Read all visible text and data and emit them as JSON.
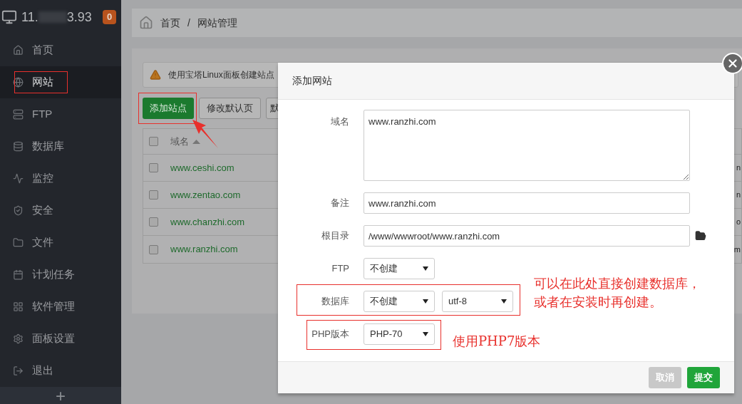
{
  "sidebar": {
    "server": {
      "ip_start": "11.",
      "ip_end": "3.93",
      "badge": "0"
    },
    "items": [
      {
        "label": "首页",
        "selected": false
      },
      {
        "label": "网站",
        "selected": true
      },
      {
        "label": "FTP",
        "selected": false
      },
      {
        "label": "数据库",
        "selected": false
      },
      {
        "label": "监控",
        "selected": false
      },
      {
        "label": "安全",
        "selected": false
      },
      {
        "label": "文件",
        "selected": false
      },
      {
        "label": "计划任务",
        "selected": false
      },
      {
        "label": "软件管理",
        "selected": false
      },
      {
        "label": "面板设置",
        "selected": false
      },
      {
        "label": "退出",
        "selected": false
      }
    ],
    "add": "+"
  },
  "breadcrumb": {
    "items": [
      "首页",
      "网站管理"
    ],
    "separator": "/"
  },
  "alert": "使用宝塔Linux面板创建站点",
  "toolbar": [
    {
      "label": "添加站点",
      "kind": "primary"
    },
    {
      "label": "修改默认页",
      "kind": "default"
    },
    {
      "label": "默",
      "kind": "default"
    }
  ],
  "table": {
    "columns": [
      "域名"
    ],
    "header_checked": false,
    "rows": [
      {
        "checked": false,
        "domain": "www.ceshi.com",
        "column_3": "n"
      },
      {
        "checked": false,
        "domain": "www.zentao.com",
        "column_3": "n"
      },
      {
        "checked": false,
        "domain": "www.chanzhi.com",
        "column_3": "o"
      },
      {
        "checked": false,
        "domain": "www.ranzhi.com",
        "column_3": "m"
      }
    ]
  },
  "dialog": {
    "title": "添加网站",
    "fields": [
      {
        "kind": "textarea",
        "label": "域名",
        "value": "www.ranzhi.com"
      },
      {
        "kind": "input",
        "label": "备注",
        "value": "www.ranzhi.com"
      },
      {
        "kind": "path",
        "label": "根目录",
        "value": "/www/wwwroot/www.ranzhi.com"
      },
      {
        "kind": "select",
        "label": "FTP",
        "values": [
          "不创建"
        ]
      },
      {
        "kind": "select",
        "label": "数据库",
        "values": [
          "不创建",
          "utf-8"
        ]
      },
      {
        "kind": "select",
        "label": "PHP版本",
        "values": [
          "PHP-70"
        ]
      }
    ],
    "buttons": [
      {
        "label": "取消",
        "kind": "cancel"
      },
      {
        "label": "提交",
        "kind": "submit"
      }
    ]
  },
  "notes": [
    {
      "lines": [
        "可以在此处直接创建数据库，",
        "或者在安装时再创建。"
      ]
    },
    {
      "lines": [
        "使用PHP7版本"
      ]
    }
  ]
}
